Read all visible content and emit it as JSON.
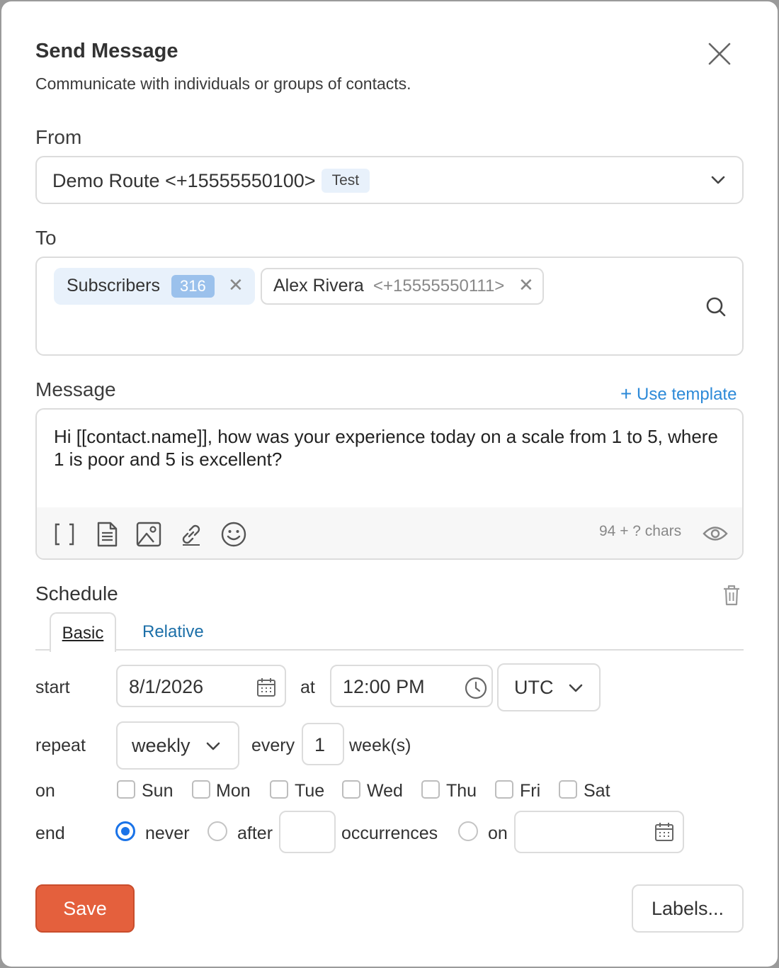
{
  "dialog": {
    "title": "Send Message",
    "subtitle": "Communicate with individuals or groups of contacts."
  },
  "from": {
    "label": "From",
    "value": "Demo Route <+15555550100>",
    "badge": "Test"
  },
  "to": {
    "label": "To",
    "chips": [
      {
        "name": "Subscribers",
        "count": "316"
      },
      {
        "name": "Alex Rivera",
        "detail": "<+15555550111>"
      }
    ]
  },
  "message": {
    "label": "Message",
    "use_template": "Use template",
    "text": "Hi [[contact.name]], how was your experience today on a scale from 1 to 5, where 1 is poor and 5 is excellent?",
    "chars": "94 + ? chars",
    "toolbar_icons": [
      "brackets-icon",
      "document-icon",
      "image-icon",
      "link-icon",
      "emoji-icon"
    ]
  },
  "schedule": {
    "label": "Schedule",
    "tabs": [
      "Basic",
      "Relative"
    ],
    "start_label": "start",
    "start_date": "8/1/2026",
    "at_label": "at",
    "start_time": "12:00 PM",
    "timezone": "UTC",
    "repeat_label": "repeat",
    "repeat_value": "weekly",
    "every_label": "every",
    "every_value": "1",
    "every_unit": "week(s)",
    "on_label": "on",
    "days": [
      "Sun",
      "Mon",
      "Tue",
      "Wed",
      "Thu",
      "Fri",
      "Sat"
    ],
    "end_label": "end",
    "end_never": "never",
    "end_after": "after",
    "end_occurrences": "occurrences",
    "end_on": "on",
    "end_selected": "never"
  },
  "actions": {
    "save": "Save",
    "labels": "Labels..."
  },
  "colors": {
    "primary_button": "#e4603d",
    "accent": "#2d8ad8",
    "radio_selected": "#1a73e8"
  }
}
